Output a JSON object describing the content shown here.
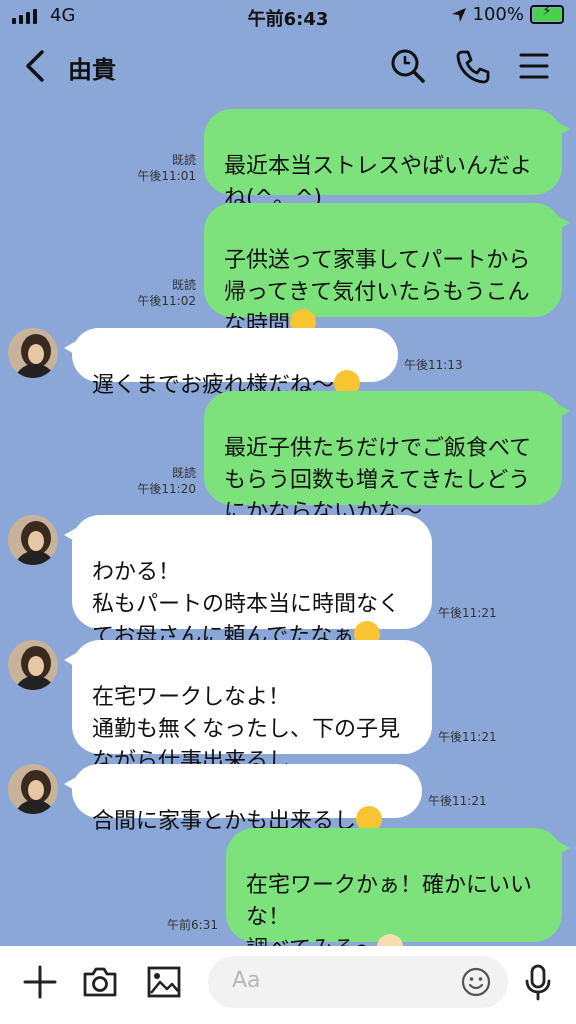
{
  "status": {
    "network": "4G",
    "time": "午前6:43",
    "battery": "100%",
    "battery_level": 1.0
  },
  "header": {
    "back_icon": "chevron-left-icon",
    "contact_name": "由貴",
    "icons": [
      "search-icon",
      "phone-icon",
      "menu-icon"
    ]
  },
  "messages": [
    {
      "side": "me",
      "text": "最近本当ストレスやばいんだよ\nね(^。^)",
      "read": "既読",
      "time": "午後11:01"
    },
    {
      "side": "me",
      "text": "子供送って家事してパートから\n帰ってきて気付いたらもうこん\nな時間",
      "emoji": "sweat-smile",
      "read": "既読",
      "time": "午後11:02"
    },
    {
      "side": "them",
      "text": "遅くまでお疲れ様だね〜",
      "emoji": "confounded",
      "time": "午後11:13"
    },
    {
      "side": "me",
      "text": "最近子供たちだけでご飯食べて\nもらう回数も増えてきたしどう\nにかならないかな〜",
      "read": "既読",
      "time": "午後11:20"
    },
    {
      "side": "them",
      "text": "わかる！\n私もパートの時本当に時間なく\nてお母さんに頼んでたなぁ",
      "emoji": "tired",
      "time": "午後11:21"
    },
    {
      "side": "them",
      "text": "在宅ワークしなよ！\n通勤も無くなったし、下の子見\nながら仕事出来るし",
      "time": "午後11:21"
    },
    {
      "side": "them",
      "text": "合間に家事とかも出来るし",
      "emoji": "kissing",
      "time": "午後11:21"
    },
    {
      "side": "me",
      "text": "在宅ワークかぁ！確かにいい\nな！\n調べてみる〜",
      "emoji": "raised-hands",
      "time": "午前6:31"
    }
  ],
  "composer": {
    "placeholder": "Aa",
    "icons": [
      "plus-icon",
      "camera-icon",
      "image-icon",
      "emoji-icon",
      "mic-icon"
    ]
  }
}
